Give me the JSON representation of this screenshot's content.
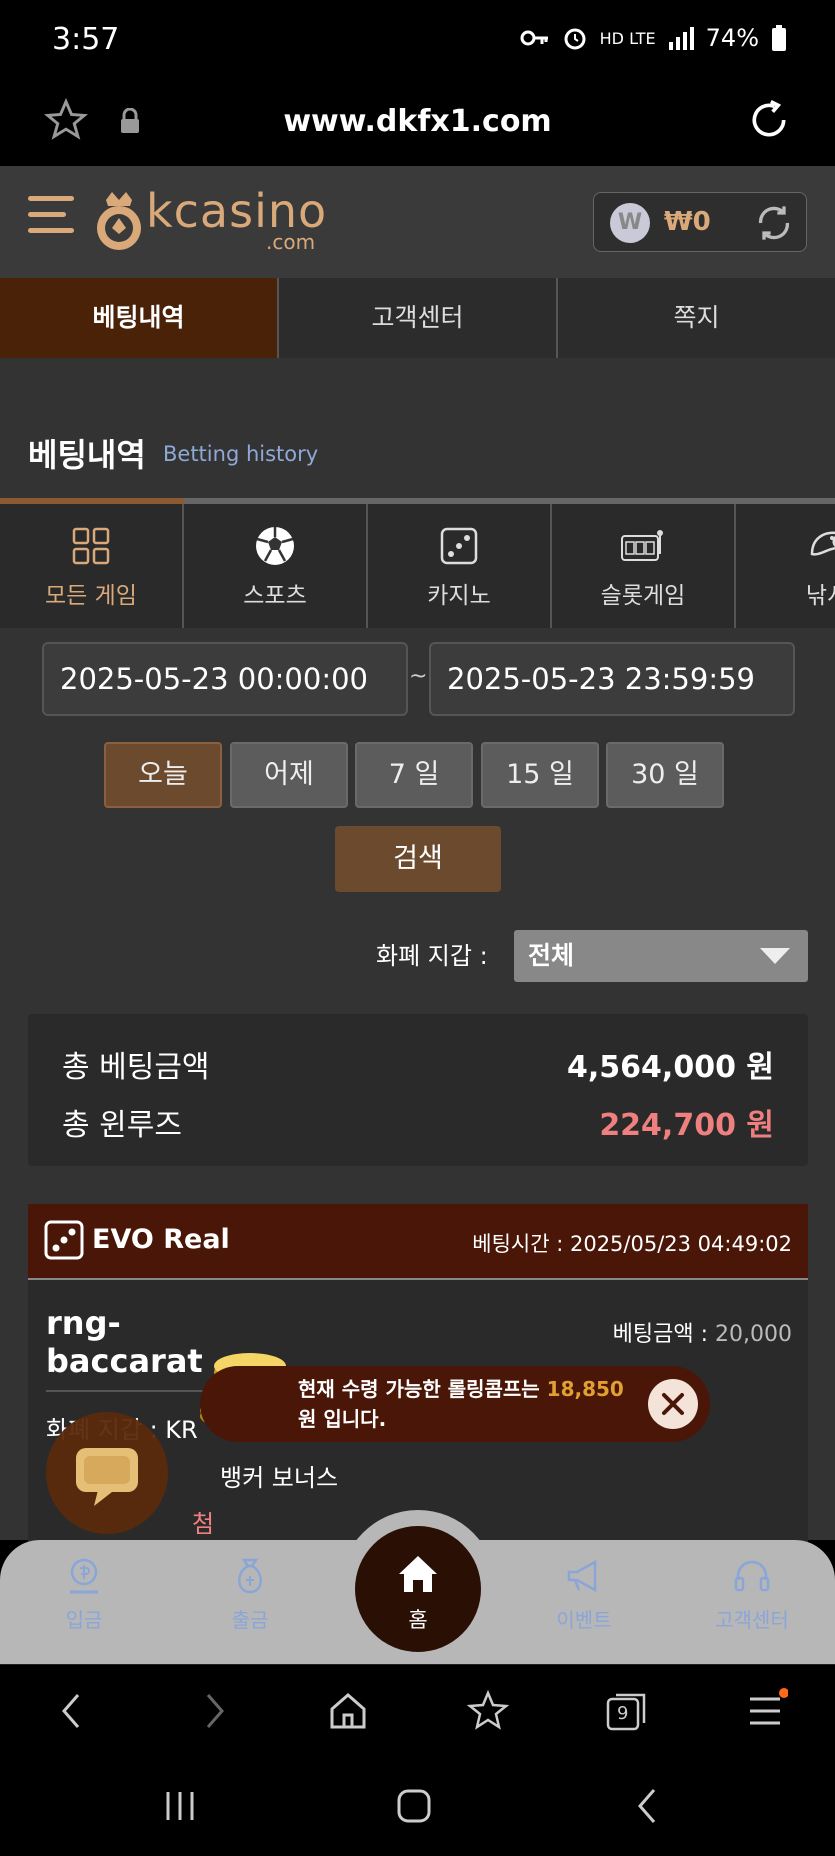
{
  "status_bar": {
    "time": "3:57",
    "indicators": "HD LTE",
    "battery": "74%"
  },
  "browser": {
    "url": "www.dkfx1.com",
    "tab_count": "9"
  },
  "header": {
    "logo_text": "kcasino",
    "logo_suffix": ".com",
    "wallet_symbol": "W",
    "wallet_balance": "₩0"
  },
  "top_tabs": [
    {
      "label": "베팅내역",
      "active": true
    },
    {
      "label": "고객센터",
      "active": false
    },
    {
      "label": "쪽지",
      "active": false
    }
  ],
  "section": {
    "title": "베팅내역",
    "subtitle": "Betting history"
  },
  "game_tabs": [
    {
      "label": "모든 게임",
      "icon": "grid-icon",
      "active": true
    },
    {
      "label": "스포츠",
      "icon": "soccer-ball-icon",
      "active": false
    },
    {
      "label": "카지노",
      "icon": "dice-icon",
      "active": false
    },
    {
      "label": "슬롯게임",
      "icon": "slot-machine-icon",
      "active": false
    },
    {
      "label": "낚시",
      "icon": "fish-icon",
      "active": false
    }
  ],
  "date_range": {
    "start": "2025-05-23 00:00:00",
    "separator": "~",
    "end": "2025-05-23 23:59:59"
  },
  "periods": [
    {
      "label": "오늘",
      "active": true
    },
    {
      "label": "어제",
      "active": false
    },
    {
      "label": "7 일",
      "active": false
    },
    {
      "label": "15 일",
      "active": false
    },
    {
      "label": "30 일",
      "active": false
    }
  ],
  "search_label": "검색",
  "currency": {
    "label": "화폐 지갑 :",
    "selected": "전체"
  },
  "summary": {
    "total_bet_label": "총 베팅금액",
    "total_bet_value": "4,564,000 원",
    "total_winloss_label": "총 윈루즈",
    "total_winloss_value": "224,700 원"
  },
  "bet": {
    "provider": "EVO Real",
    "time_label": "베팅시간 :",
    "time_value": "2025/05/23 04:49:02",
    "game": "rng-baccarat",
    "amount_label": "베팅금액 :",
    "amount_value": "20,000",
    "currency_row": "화폐 지갑 : KR",
    "bet_type_row": "뱅커 보너스",
    "result_row": "첨"
  },
  "toast": {
    "line1_prefix": "현재 수령 가능한 롤링콤프는",
    "line1_value": "18,850",
    "line2": "원 입니다."
  },
  "bottom_nav": {
    "deposit": "입금",
    "withdraw": "출금",
    "home": "홈",
    "event": "이벤트",
    "support": "고객센터"
  },
  "colors": {
    "accent": "#d9a97a",
    "active_tab": "#4a2208",
    "winloss": "#f08080",
    "highlight": "#e0a032"
  }
}
